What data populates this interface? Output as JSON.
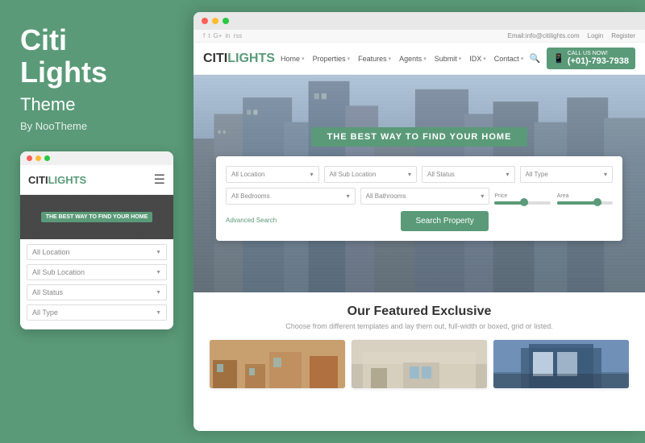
{
  "left": {
    "brand_name_line1": "Citi",
    "brand_name_line2": "Lights",
    "brand_subtitle": "Theme",
    "brand_by": "By NooTheme",
    "mobile": {
      "dots": [
        "red",
        "yellow",
        "green"
      ],
      "logo_citi": "CITI",
      "logo_lights": "LIGHTS",
      "hero_text": "THE BEST WAY TO FIND",
      "selects": [
        {
          "label": "All Location"
        },
        {
          "label": "All Sub Location"
        },
        {
          "label": "All Status"
        },
        {
          "label": "All Type"
        }
      ]
    }
  },
  "browser": {
    "dots": [
      "red",
      "yellow",
      "green"
    ],
    "topbar": {
      "social_icons": [
        "f",
        "t",
        "g+",
        "in",
        "rss"
      ],
      "email": "Email:info@citilights.com",
      "login": "Login",
      "register": "Register"
    },
    "navbar": {
      "logo_citi": "CITI",
      "logo_lights": "LIGHTS",
      "nav_items": [
        {
          "label": "Home",
          "has_arrow": true
        },
        {
          "label": "Properties",
          "has_arrow": true
        },
        {
          "label": "Features",
          "has_arrow": true
        },
        {
          "label": "Agents",
          "has_arrow": true
        },
        {
          "label": "Submit",
          "has_arrow": true
        },
        {
          "label": "IDX",
          "has_arrow": true
        },
        {
          "label": "Contact",
          "has_arrow": true
        }
      ],
      "call_label": "CALL US NOW!",
      "phone": "(+01)-793-7938"
    },
    "hero": {
      "title": "THE BEST WAY TO FIND YOUR HOME",
      "search": {
        "row1": [
          {
            "label": "All Location"
          },
          {
            "label": "All Sub Location"
          },
          {
            "label": "All Status"
          },
          {
            "label": "All Type"
          }
        ],
        "row2": [
          {
            "label": "All Bedrooms"
          },
          {
            "label": "All Bathrooms"
          }
        ],
        "price_label": "Price",
        "area_label": "Area",
        "advanced_search": "Advanced Search",
        "search_button": "Search Property"
      }
    },
    "featured": {
      "title": "Our Featured Exclusive",
      "subtitle": "Choose from different templates and lay them out, full-width or boxed, grid or listed.",
      "properties": [
        {
          "type": "interior"
        },
        {
          "type": "room"
        },
        {
          "type": "exterior"
        }
      ]
    }
  }
}
